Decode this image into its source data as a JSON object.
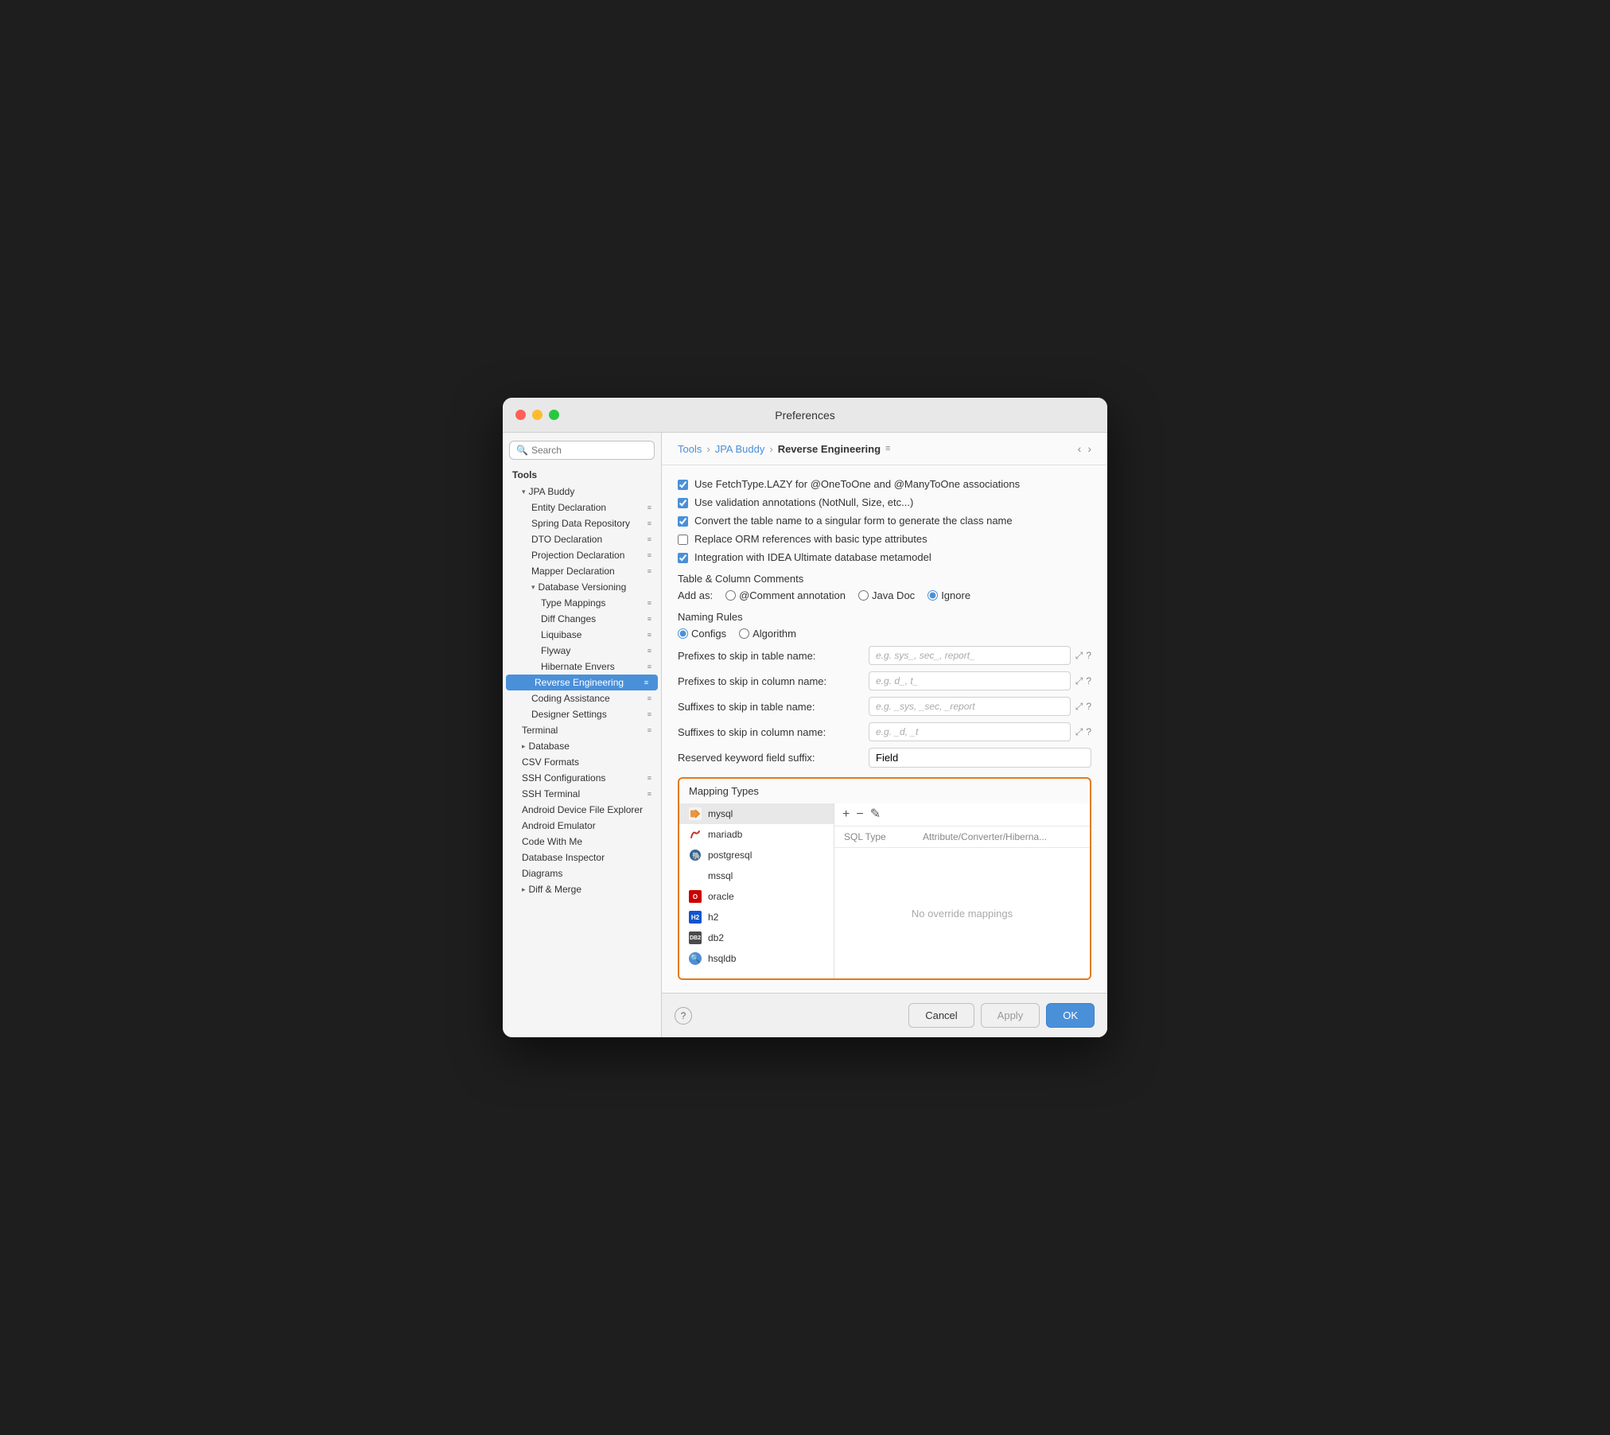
{
  "window": {
    "title": "Preferences"
  },
  "sidebar": {
    "search_placeholder": "Search",
    "sections": [
      {
        "label": "Tools",
        "items": [
          {
            "id": "jpa-buddy",
            "label": "JPA Buddy",
            "indent": 1,
            "type": "group",
            "expanded": true
          },
          {
            "id": "entity-declaration",
            "label": "Entity Declaration",
            "indent": 2,
            "type": "item",
            "has_icon": true
          },
          {
            "id": "spring-data-repository",
            "label": "Spring Data Repository",
            "indent": 2,
            "type": "item",
            "has_icon": true
          },
          {
            "id": "dto-declaration",
            "label": "DTO Declaration",
            "indent": 2,
            "type": "item",
            "has_icon": true
          },
          {
            "id": "projection-declaration",
            "label": "Projection Declaration",
            "indent": 2,
            "type": "item",
            "has_icon": true
          },
          {
            "id": "mapper-declaration",
            "label": "Mapper Declaration",
            "indent": 2,
            "type": "item",
            "has_icon": true
          },
          {
            "id": "database-versioning",
            "label": "Database Versioning",
            "indent": 2,
            "type": "group",
            "expanded": true
          },
          {
            "id": "type-mappings",
            "label": "Type Mappings",
            "indent": 3,
            "type": "item",
            "has_icon": true
          },
          {
            "id": "diff-changes",
            "label": "Diff Changes",
            "indent": 3,
            "type": "item",
            "has_icon": true
          },
          {
            "id": "liquibase",
            "label": "Liquibase",
            "indent": 3,
            "type": "item",
            "has_icon": true
          },
          {
            "id": "flyway",
            "label": "Flyway",
            "indent": 3,
            "type": "item",
            "has_icon": true
          },
          {
            "id": "hibernate-envers",
            "label": "Hibernate Envers",
            "indent": 3,
            "type": "item",
            "has_icon": true
          },
          {
            "id": "reverse-engineering",
            "label": "Reverse Engineering",
            "indent": 2,
            "type": "item",
            "active": true,
            "has_icon": true
          },
          {
            "id": "coding-assistance",
            "label": "Coding Assistance",
            "indent": 2,
            "type": "item",
            "has_icon": true
          },
          {
            "id": "designer-settings",
            "label": "Designer Settings",
            "indent": 2,
            "type": "item",
            "has_icon": true
          },
          {
            "id": "terminal",
            "label": "Terminal",
            "indent": 1,
            "type": "item",
            "has_icon": true
          },
          {
            "id": "database",
            "label": "Database",
            "indent": 1,
            "type": "group-collapsed"
          },
          {
            "id": "csv-formats",
            "label": "CSV Formats",
            "indent": 1,
            "type": "item"
          },
          {
            "id": "ssh-configurations",
            "label": "SSH Configurations",
            "indent": 1,
            "type": "item",
            "has_icon": true
          },
          {
            "id": "ssh-terminal",
            "label": "SSH Terminal",
            "indent": 1,
            "type": "item",
            "has_icon": true
          },
          {
            "id": "android-device-file-explorer",
            "label": "Android Device File Explorer",
            "indent": 1,
            "type": "item"
          },
          {
            "id": "android-emulator",
            "label": "Android Emulator",
            "indent": 1,
            "type": "item"
          },
          {
            "id": "code-with-me",
            "label": "Code With Me",
            "indent": 1,
            "type": "item"
          },
          {
            "id": "database-inspector",
            "label": "Database Inspector",
            "indent": 1,
            "type": "item"
          },
          {
            "id": "diagrams",
            "label": "Diagrams",
            "indent": 1,
            "type": "item"
          },
          {
            "id": "diff-merge",
            "label": "Diff & Merge",
            "indent": 1,
            "type": "group-collapsed"
          }
        ]
      }
    ]
  },
  "breadcrumb": {
    "parts": [
      "Tools",
      "JPA Buddy",
      "Reverse Engineering"
    ],
    "nav_icon": "≡"
  },
  "settings": {
    "title": "Reverse Engineering",
    "checkboxes": [
      {
        "id": "fetch-lazy",
        "label": "Use FetchType.LAZY for @OneToOne and @ManyToOne associations",
        "checked": true
      },
      {
        "id": "validation-annotations",
        "label": "Use validation annotations (NotNull, Size, etc...)",
        "checked": true
      },
      {
        "id": "singular-form",
        "label": "Convert the table name to a singular form to generate the class name",
        "checked": true
      },
      {
        "id": "replace-orm",
        "label": "Replace ORM references with basic type attributes",
        "checked": false
      },
      {
        "id": "idea-integration",
        "label": "Integration with IDEA Ultimate database metamodel",
        "checked": true
      }
    ],
    "table_column_comments_label": "Table & Column Comments",
    "add_as_label": "Add as:",
    "add_as_options": [
      {
        "id": "comment-annotation",
        "label": "@Comment annotation",
        "selected": false
      },
      {
        "id": "java-doc",
        "label": "Java Doc",
        "selected": false
      },
      {
        "id": "ignore",
        "label": "Ignore",
        "selected": true
      }
    ],
    "naming_rules_label": "Naming Rules",
    "naming_options": [
      {
        "id": "configs",
        "label": "Configs",
        "selected": true
      },
      {
        "id": "algorithm",
        "label": "Algorithm",
        "selected": false
      }
    ],
    "fields": [
      {
        "id": "prefix-table",
        "label": "Prefixes to skip in table name:",
        "placeholder": "e.g. sys_, sec_, report_"
      },
      {
        "id": "prefix-column",
        "label": "Prefixes to skip in column name:",
        "placeholder": "e.g. d_, t_"
      },
      {
        "id": "suffix-table",
        "label": "Suffixes to skip in table name:",
        "placeholder": "e.g. _sys, _sec, _report"
      },
      {
        "id": "suffix-column",
        "label": "Suffixes to skip in column name:",
        "placeholder": "e.g. _d, _t"
      }
    ],
    "reserved_keyword_label": "Reserved keyword field suffix:",
    "reserved_keyword_value": "Field",
    "mapping_types_label": "Mapping Types",
    "databases": [
      {
        "id": "mysql",
        "label": "mysql",
        "icon_type": "mysql",
        "selected": true
      },
      {
        "id": "mariadb",
        "label": "mariadb",
        "icon_type": "mariadb"
      },
      {
        "id": "postgresql",
        "label": "postgresql",
        "icon_type": "postgresql"
      },
      {
        "id": "mssql",
        "label": "mssql",
        "icon_type": "mssql"
      },
      {
        "id": "oracle",
        "label": "oracle",
        "icon_type": "oracle"
      },
      {
        "id": "h2",
        "label": "h2",
        "icon_type": "h2"
      },
      {
        "id": "db2",
        "label": "db2",
        "icon_type": "db2"
      },
      {
        "id": "hsqldb",
        "label": "hsqldb",
        "icon_type": "hsqldb"
      }
    ],
    "sql_type_col": "SQL Type",
    "attr_col": "Attribute/Converter/Hiberna...",
    "no_override_text": "No override mappings"
  },
  "footer": {
    "cancel_label": "Cancel",
    "apply_label": "Apply",
    "ok_label": "OK",
    "help_label": "?"
  }
}
